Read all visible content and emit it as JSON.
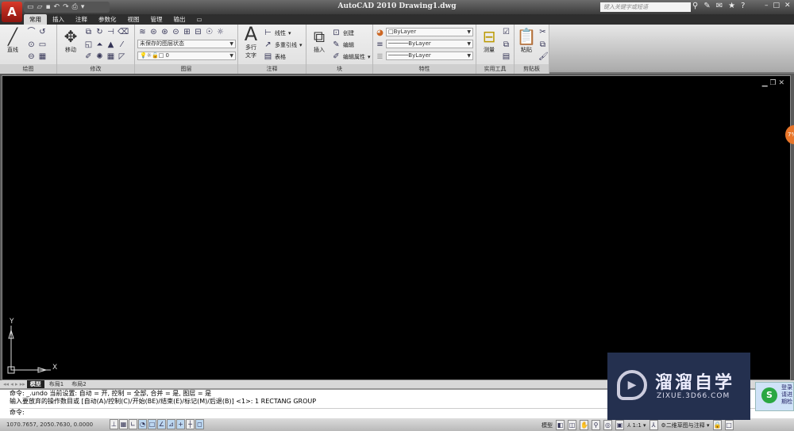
{
  "window": {
    "title": "AutoCAD 2010  Drawing1.dwg",
    "search_placeholder": "键入关键字或短语",
    "logo": "A"
  },
  "tabs": [
    "常用",
    "插入",
    "注释",
    "参数化",
    "视图",
    "管理",
    "输出"
  ],
  "panels": {
    "draw": {
      "label": "绘图",
      "line": "直线"
    },
    "modify": {
      "label": "修改",
      "move": "移动"
    },
    "layers": {
      "label": "图层",
      "layer_state": "未保存的图层状态",
      "current_layer": "0"
    },
    "annotation": {
      "label": "注释",
      "mtext": "多行\n文字",
      "linear": "线性",
      "mleader": "多重引线",
      "table": "表格"
    },
    "block": {
      "label": "块",
      "insert": "插入",
      "create": "创建",
      "edit": "编辑",
      "edit_attr": "编辑属性"
    },
    "properties": {
      "label": "特性",
      "color": "ByLayer",
      "linetype": "ByLayer",
      "lineweight": "ByLayer"
    },
    "utilities": {
      "label": "实用工具",
      "measure": "测量"
    },
    "clipboard": {
      "label": "剪贴板",
      "paste": "粘贴"
    }
  },
  "layout_tabs": [
    "模型",
    "布局1",
    "布局2"
  ],
  "command": {
    "line1": "命令:  _.undo 当前设置: 自动 = 开, 控制 = 全部, 合并 = 是, 图层 = 是",
    "line2": "输入要放弃的操作数目或 [自动(A)/控制(C)/开始(BE)/结束(E)/标记(M)/后退(B)] <1>: 1 RECTANG GROUP",
    "prompt": "命令:"
  },
  "status": {
    "coords": "1070.7657, 2050.7630, 0.0000",
    "model": "模型",
    "scale": "1:1",
    "workspace": "二维草图与注释"
  },
  "ucs": {
    "x": "X",
    "y": "Y"
  },
  "watermark": {
    "cn": "溜溜自学",
    "en": "ZIXUE.3D66.COM"
  },
  "popup": {
    "lines": [
      "登录",
      "请进",
      "期检"
    ]
  },
  "side_badge": "7%"
}
